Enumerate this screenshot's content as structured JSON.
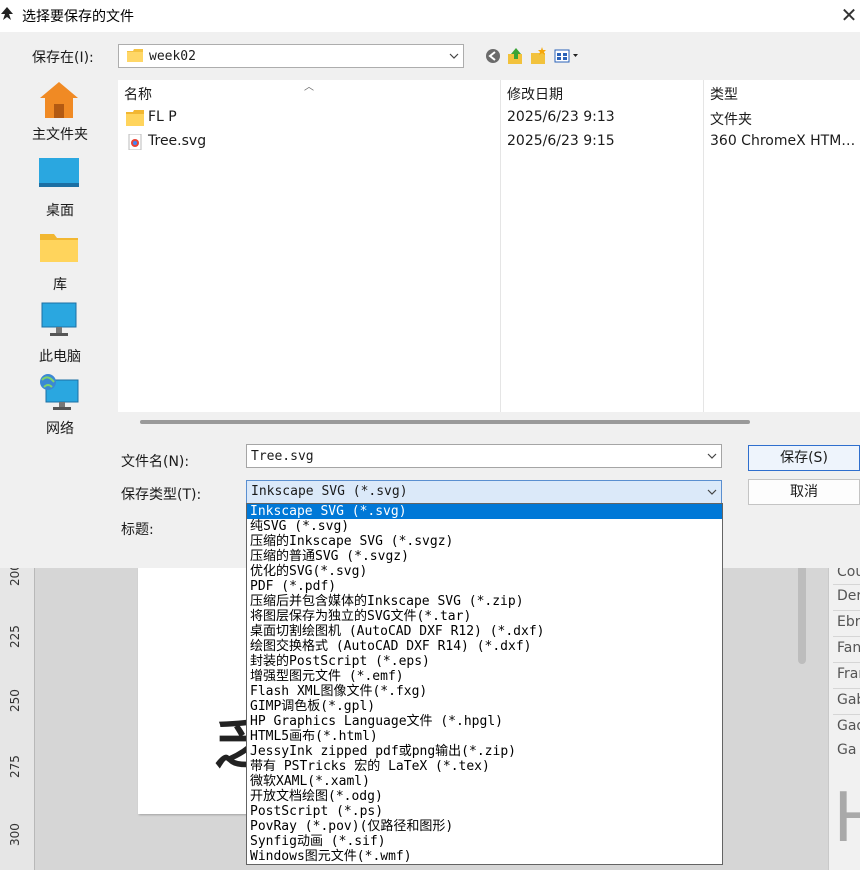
{
  "dialog": {
    "title": "选择要保存的文件",
    "close_glyph": "✕",
    "save_in_label": "保存在(I):",
    "current_folder": "week02",
    "places": [
      {
        "label": "主文件夹",
        "icon": "home-icon"
      },
      {
        "label": "桌面",
        "icon": "desktop-icon"
      },
      {
        "label": "库",
        "icon": "library-icon"
      },
      {
        "label": "此电脑",
        "icon": "computer-icon"
      },
      {
        "label": "网络",
        "icon": "network-icon"
      }
    ],
    "columns": {
      "name": "名称",
      "date": "修改日期",
      "type": "类型"
    },
    "files": [
      {
        "name": "FL P",
        "date": "2025/6/23 9:13",
        "type": "文件夹",
        "icon": "folder-icon"
      },
      {
        "name": "Tree.svg",
        "date": "2025/6/23 9:15",
        "type": "360 ChromeX HTM…",
        "icon": "browser-file-icon"
      }
    ],
    "filename_label": "文件名(N):",
    "filename_value": "Tree.svg",
    "filetype_label": "保存类型(T):",
    "filetype_value": "Inkscape SVG (*.svg)",
    "title_label": "标题:",
    "save_button": "保存(S)",
    "cancel_button": "取消"
  },
  "filetype_options": [
    "Inkscape SVG (*.svg)",
    "纯SVG (*.svg)",
    "压缩的Inkscape SVG (*.svgz)",
    "压缩的普通SVG (*.svgz)",
    "优化的SVG(*.svg)",
    "PDF (*.pdf)",
    "压缩后并包含媒体的Inkscape SVG (*.zip)",
    "将图层保存为独立的SVG文件(*.tar)",
    "桌面切割绘图机 (AutoCAD DXF R12) (*.dxf)",
    "绘图交换格式 (AutoCAD DXF R14) (*.dxf)",
    "封装的PostScript (*.eps)",
    "增强型图元文件 (*.emf)",
    "Flash XML图像文件(*.fxg)",
    "GIMP调色板(*.gpl)",
    "HP Graphics Language文件 (*.hpgl)",
    "HTML5画布(*.html)",
    "JessyInk zipped pdf或png输出(*.zip)",
    "带有 PSTricks 宏的 LaTeX (*.tex)",
    "微软XAML(*.xaml)",
    "开放文档绘图(*.odg)",
    "PostScript (*.ps)",
    "PovRay (*.pov)(仅路径和图形)",
    "Synfig动画 (*.sif)",
    "Windows图元文件(*.wmf)"
  ],
  "background": {
    "ruler_numbers": [
      "200",
      "225",
      "250",
      "275",
      "300"
    ],
    "panel_items": [
      "Cou",
      "Der",
      "Ebr",
      "Fan",
      "Fran",
      "Gab",
      "Gad",
      "Ga"
    ],
    "panel_big_letter": "H",
    "canvas_glyph": "乏"
  },
  "colors": {
    "selection": "#0078d7",
    "accent_border": "#2f6fce"
  }
}
